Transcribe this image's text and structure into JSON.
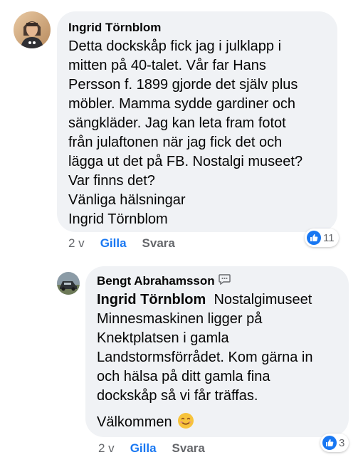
{
  "comment1": {
    "author": "Ingrid Törnblom",
    "lines": [
      "Detta dockskåp fick jag i julklapp i",
      "mitten på 40-talet. Vår far Hans",
      "Persson f. 1899 gjorde det själv plus",
      "möbler. Mamma sydde gardiner och",
      "sängkläder. Jag kan leta fram fotot",
      "från julaftonen när jag fick det och",
      "lägga ut det på FB. Nostalgi museet?",
      "Var finns det?",
      "Vänliga hälsningar",
      "Ingrid Törnblom"
    ],
    "time": "2 v",
    "like_label": "Gilla",
    "reply_label": "Svara",
    "reaction_count": "11"
  },
  "comment2": {
    "author": "Bengt Abrahamsson",
    "mention": "Ingrid Törnblom",
    "first_line_rest": "Nostalgimuseet",
    "lines": [
      "Minnesmaskinen ligger på",
      "Knektplatsen i gamla",
      "Landstormsförrådet. Kom gärna in",
      "och hälsa på ditt gamla fina",
      "dockskåp så vi får träffas."
    ],
    "closing": "Välkommen",
    "emoji": "😊",
    "time": "2 v",
    "like_label": "Gilla",
    "reply_label": "Svara",
    "reaction_count": "3"
  },
  "icons": {
    "author_badge": "speech-bubble-icon",
    "reaction": "thumbs-up-icon"
  },
  "colors": {
    "bubble": "#f0f2f5",
    "like_blue": "#1877f2",
    "meta_grey": "#65676b"
  }
}
